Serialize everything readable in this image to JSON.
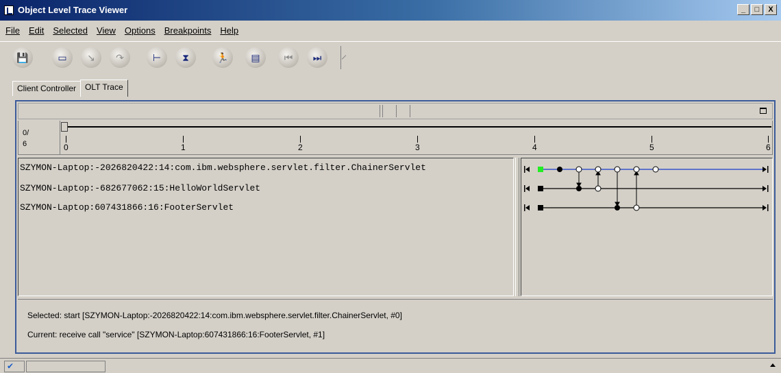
{
  "window": {
    "title": "Object Level Trace Viewer",
    "min_label": "_",
    "max_label": "□",
    "close_label": "X"
  },
  "menu": [
    "File",
    "Edit",
    "Selected",
    "View",
    "Options",
    "Breakpoints",
    "Help"
  ],
  "toolbar": [
    {
      "name": "save-icon",
      "glyph": "💾",
      "enabled": true
    },
    {
      "name": "monitor-icon",
      "glyph": "▭",
      "enabled": true
    },
    {
      "name": "step-into-icon",
      "glyph": "↘",
      "enabled": false
    },
    {
      "name": "step-over-icon",
      "glyph": "↷",
      "enabled": false
    },
    {
      "name": "hierarchy-icon",
      "glyph": "⊢",
      "enabled": true
    },
    {
      "name": "hourglass-icon",
      "glyph": "⧗",
      "enabled": true
    },
    {
      "name": "runner-icon",
      "glyph": "🏃",
      "enabled": true
    },
    {
      "name": "list-icon",
      "glyph": "▤",
      "enabled": true
    },
    {
      "name": "first-icon",
      "glyph": "⏮",
      "enabled": false
    },
    {
      "name": "last-icon",
      "glyph": "⏭",
      "enabled": true
    }
  ],
  "tabs": [
    {
      "label": "Client Controller",
      "active": false
    },
    {
      "label": "OLT Trace",
      "active": true
    }
  ],
  "ruler": {
    "count_top": "0/",
    "count_bottom": "6",
    "ticks": [
      "0",
      "1",
      "2",
      "3",
      "4",
      "5",
      "6"
    ]
  },
  "threads": [
    "SZYMON-Laptop:-2026820422:14:com.ibm.websphere.servlet.filter.ChainerServlet",
    "SZYMON-Laptop:-682677062:15:HelloWorldServlet",
    "SZYMON-Laptop:607431866:16:FooterServlet"
  ],
  "status": {
    "selected": "Selected:  start [SZYMON-Laptop:-2026820422:14:com.ibm.websphere.servlet.filter.ChainerServlet, #0]",
    "current": "Current:  receive call \"service\" [SZYMON-Laptop:607431866:16:FooterServlet, #1]"
  },
  "colors": {
    "selected_line": "#1c3ccc",
    "start_marker": "#22ee22",
    "border_accent": "#3a5a9a"
  }
}
